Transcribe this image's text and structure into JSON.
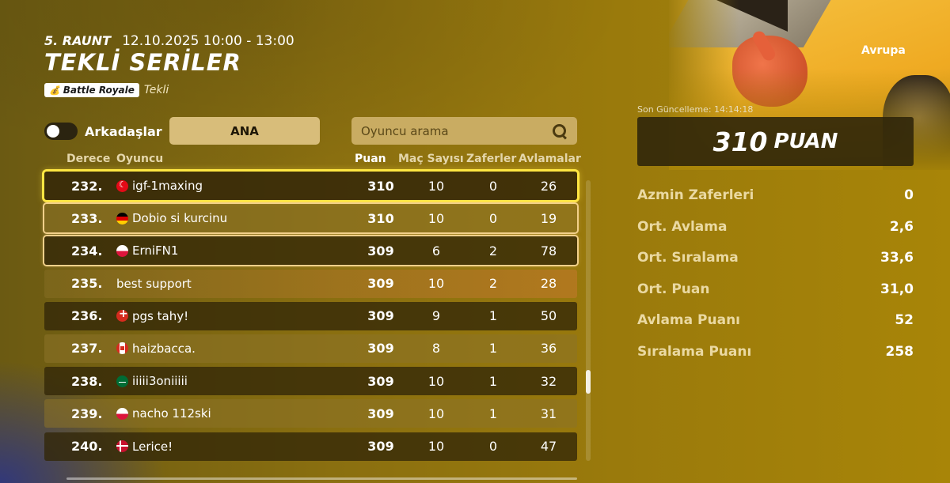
{
  "header": {
    "round": "5. RAUNT",
    "datetime": "12.10.2025 10:00 - 13:00",
    "title": "TEKLİ SERİLER",
    "mode_badge": "Battle Royale",
    "mode_sub": "Tekli"
  },
  "controls": {
    "friends_label": "Arkadaşlar",
    "friends_toggle_on": false,
    "ana_label": "ANA",
    "search_placeholder": "Oyuncu arama"
  },
  "table": {
    "columns": {
      "rank": "Derece",
      "player": "Oyuncu",
      "points": "Puan",
      "matches": "Maç Sayısı",
      "wins": "Zaferler",
      "elims": "Avlamalar"
    },
    "rows": [
      {
        "rank": "232.",
        "flag": "tr",
        "name": "igf-1maxing",
        "points": "310",
        "matches": "10",
        "wins": "0",
        "elims": "26"
      },
      {
        "rank": "233.",
        "flag": "de",
        "name": "Dobio si kurcinu",
        "points": "310",
        "matches": "10",
        "wins": "0",
        "elims": "19"
      },
      {
        "rank": "234.",
        "flag": "pl",
        "name": "ErniFN1",
        "points": "309",
        "matches": "6",
        "wins": "2",
        "elims": "78"
      },
      {
        "rank": "235.",
        "flag": "",
        "name": "best support",
        "points": "309",
        "matches": "10",
        "wins": "2",
        "elims": "28"
      },
      {
        "rank": "236.",
        "flag": "ch",
        "name": "pgs tahy!",
        "points": "309",
        "matches": "9",
        "wins": "1",
        "elims": "50"
      },
      {
        "rank": "237.",
        "flag": "ca",
        "name": "haizbacca.",
        "points": "309",
        "matches": "8",
        "wins": "1",
        "elims": "36"
      },
      {
        "rank": "238.",
        "flag": "sa",
        "name": "iiiii3oniiiii",
        "points": "309",
        "matches": "10",
        "wins": "1",
        "elims": "32"
      },
      {
        "rank": "239.",
        "flag": "pl",
        "name": "nacho 112ski",
        "points": "309",
        "matches": "10",
        "wins": "1",
        "elims": "31"
      },
      {
        "rank": "240.",
        "flag": "dk",
        "name": "Lerice!",
        "points": "309",
        "matches": "10",
        "wins": "0",
        "elims": "47"
      }
    ]
  },
  "side": {
    "region": "Avrupa",
    "last_update": "Son Güncelleme: 14:14:18",
    "score_value": "310",
    "score_unit": "PUAN",
    "stats": [
      {
        "label": "Azmin Zaferleri",
        "value": "0"
      },
      {
        "label": "Ort. Avlama",
        "value": "2,6"
      },
      {
        "label": "Ort. Sıralama",
        "value": "33,6"
      },
      {
        "label": "Ort. Puan",
        "value": "31,0"
      },
      {
        "label": "Avlama Puanı",
        "value": "52"
      },
      {
        "label": "Sıralama Puanı",
        "value": "258"
      }
    ]
  },
  "colors": {
    "selected_outline": "#ffe642",
    "group_outline": "#f2d08a",
    "row_dark": "#322608",
    "ana_button": "#d8bd7a"
  }
}
